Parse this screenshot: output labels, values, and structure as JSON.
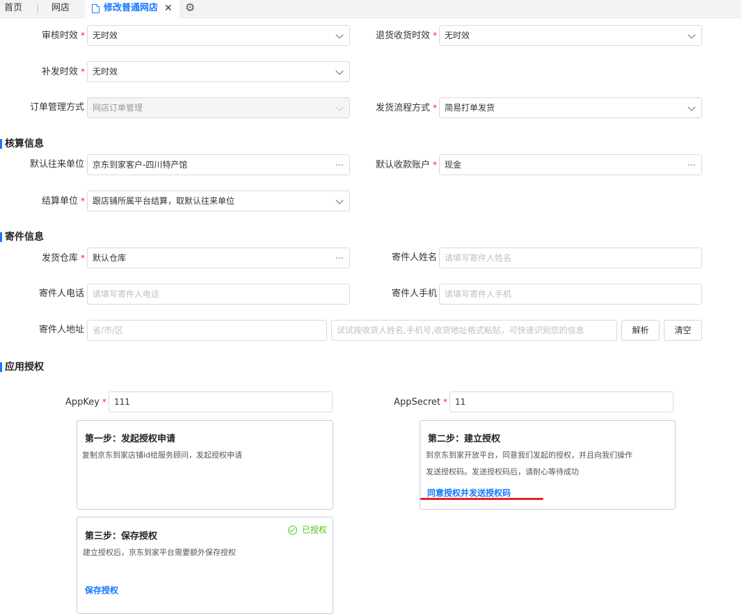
{
  "tabs": {
    "home": "首页",
    "separator": "|",
    "online_store": "网店",
    "active": "修改普通网店",
    "close": "✕",
    "settings_icon": "gear-icon"
  },
  "fields": {
    "audit_timeliness": {
      "label": "审核时效",
      "value": "无时效"
    },
    "return_timeliness": {
      "label": "退货收货时效",
      "value": "无时效"
    },
    "reissue_timeliness": {
      "label": "补发时效",
      "value": "无时效"
    },
    "order_mgmt_mode": {
      "label": "订单管理方式",
      "value": "网店订单管理"
    },
    "ship_flow_mode": {
      "label": "发货流程方式",
      "value": "简易打单发货"
    }
  },
  "sections": {
    "accounting": "核算信息",
    "sender": "寄件信息",
    "auth": "应用授权"
  },
  "accounting": {
    "default_partner": {
      "label": "默认往来单位",
      "value": "京东到家客户-四川特产馆"
    },
    "default_account": {
      "label": "默认收款账户",
      "value": "现金"
    },
    "settlement_unit": {
      "label": "结算单位",
      "value": "跟店铺所属平台结算，取默认往来单位"
    }
  },
  "sender": {
    "warehouse": {
      "label": "发货仓库",
      "value": "默认仓库"
    },
    "name": {
      "label": "寄件人姓名",
      "placeholder": "请填写寄件人姓名"
    },
    "phone": {
      "label": "寄件人电话",
      "placeholder": "请填写寄件人电话"
    },
    "mobile": {
      "label": "寄件人手机",
      "placeholder": "请填写寄件人手机"
    },
    "address": {
      "label": "寄件人地址",
      "region_placeholder": "省/市/区",
      "smart_placeholder": "试试按收货人姓名,手机号,收货地址格式粘贴，可快速识别您的信息",
      "parse_button": "解析",
      "clear_button": "清空"
    }
  },
  "auth": {
    "app_key": {
      "label": "AppKey",
      "value": "111"
    },
    "app_secret": {
      "label": "AppSecret",
      "value": "11"
    },
    "step1": {
      "title": "第一步：发起授权申请",
      "desc": "复制京东到家店铺id给服务顾问，发起授权申请"
    },
    "step2": {
      "title": "第二步：建立授权",
      "desc1": "到京东到家开放平台，同意我们发起的授权，并且向我们操作",
      "desc2": "发送授权码。发送授权码后，请耐心等待成功",
      "link": "同意授权并发送授权码"
    },
    "step3": {
      "title": "第三步：保存授权",
      "desc": "建立授权后，京东到家平台需要额外保存授权",
      "status": "已授权",
      "link": "保存授权"
    }
  },
  "required_mark": "*",
  "more_icon": "⋯",
  "colors": {
    "accent": "#1677ff",
    "required": "#f5222d",
    "success": "#52c41a",
    "highlight": "#e8231e"
  }
}
